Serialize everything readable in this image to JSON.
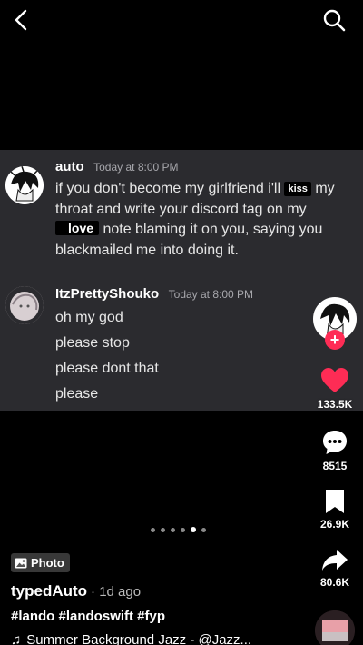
{
  "nav": {
    "back_icon": "chevron-left-icon",
    "search_icon": "search-icon"
  },
  "chat": {
    "messages": [
      {
        "author": "auto",
        "time": "Today at 8:00 PM",
        "text_before_kiss": "if you don't become my girlfriend i'll",
        "kiss_tag": "kiss",
        "text_after_kiss": " my throat and write your discord tag on my ",
        "love_tag": "love",
        "text_after_love": " note blaming it on you, saying you blackmailed me into doing it."
      },
      {
        "author": "ItzPrettyShouko",
        "time": "Today at 8:00 PM",
        "lines": [
          "oh my god",
          "please stop",
          "please dont that",
          "please"
        ]
      }
    ]
  },
  "actions": {
    "likes": "133.5K",
    "comments": "8515",
    "saves": "26.9K",
    "shares": "80.6K",
    "like_color": "#fe2c55"
  },
  "carousel": {
    "count": 6,
    "active_index": 4
  },
  "post": {
    "badge": "Photo",
    "author": "typedAuto",
    "posted": "· 1d ago",
    "caption": "#lando #landoswift #fyp",
    "music": "Summer Background Jazz - @Jazz..."
  }
}
